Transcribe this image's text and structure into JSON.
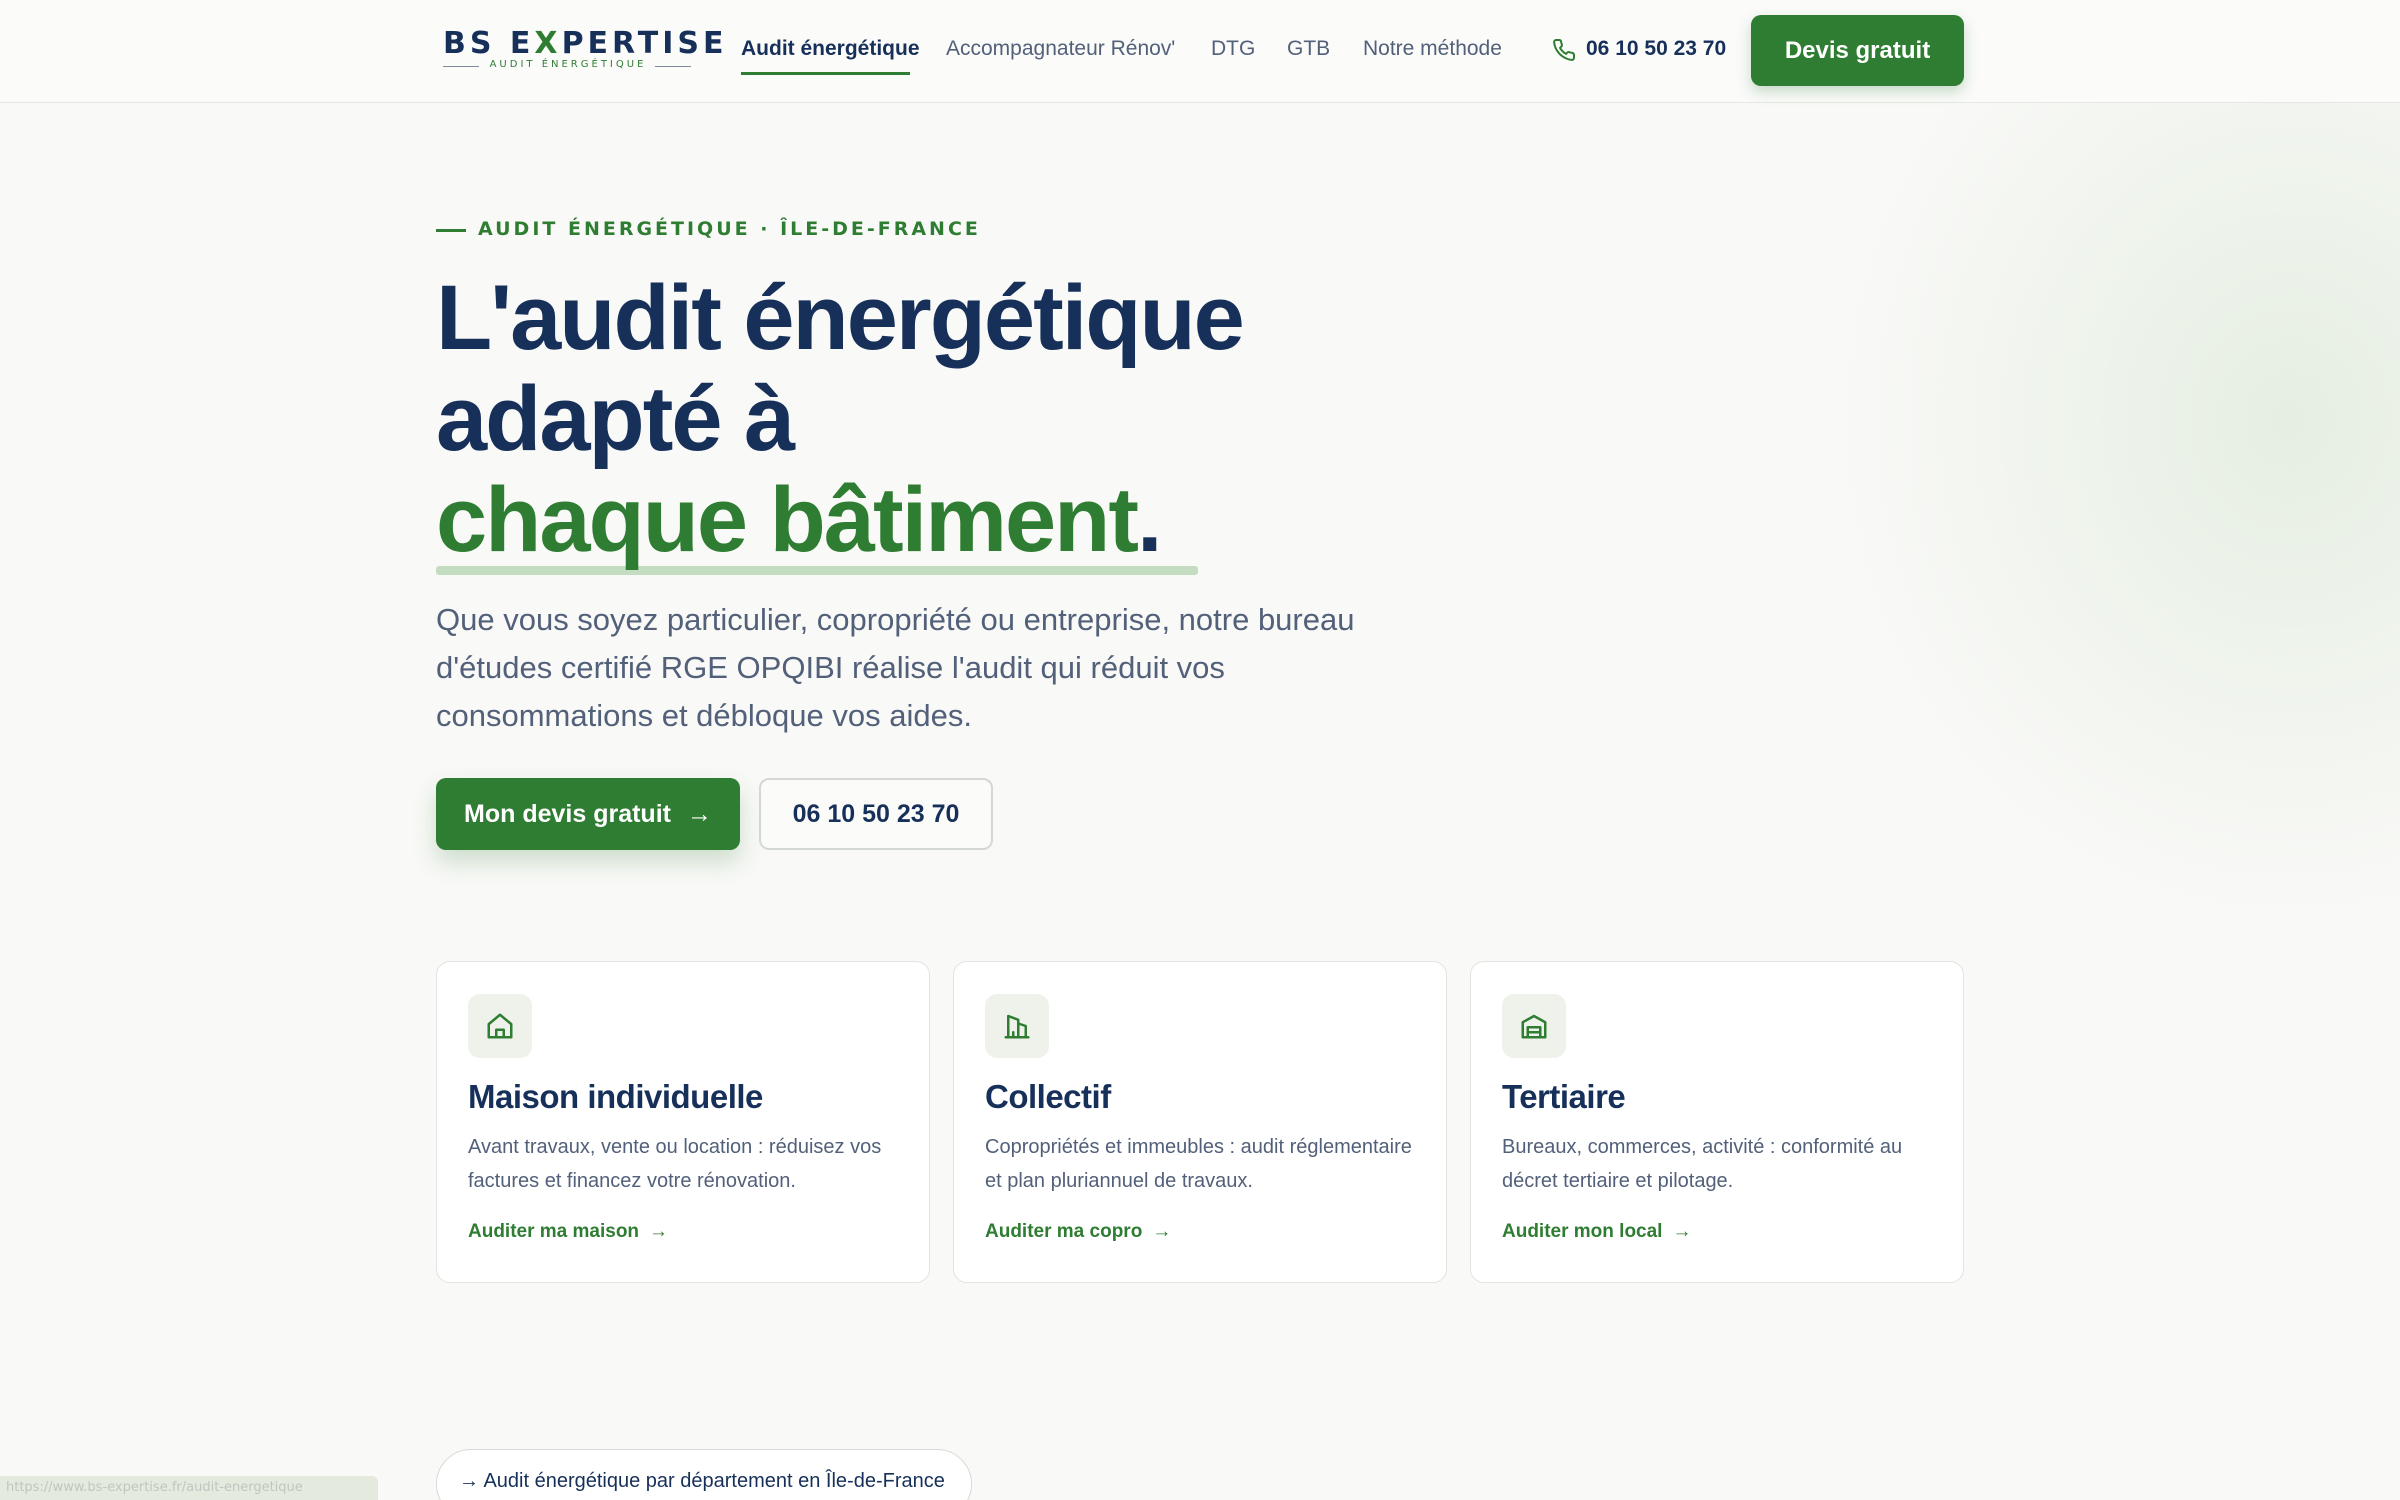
{
  "header": {
    "logo": {
      "name_prefix": "BS E",
      "name_x": "X",
      "name_suffix": "PERTISE",
      "tagline": "AUDIT ÉNERGÉTIQUE"
    },
    "nav": [
      {
        "label": "Audit énergétique",
        "active": true
      },
      {
        "label": "Accompagnateur Rénov'",
        "active": false
      },
      {
        "label": "DTG",
        "active": false
      },
      {
        "label": "GTB",
        "active": false
      },
      {
        "label": "Notre méthode",
        "active": false
      }
    ],
    "phone": "06 10 50 23 70",
    "cta_label": "Devis gratuit"
  },
  "hero": {
    "eyebrow": "AUDIT ÉNERGÉTIQUE · ÎLE-DE-FRANCE",
    "title_line1": "L'audit énergétique",
    "title_line2": "adapté à",
    "title_line3": "chaque bâtiment",
    "title_dot": ".",
    "lead": "Que vous soyez particulier, copropriété ou entreprise, notre bureau d'études certifié RGE OPQIBI réalise l'audit qui réduit vos consommations et débloque vos aides.",
    "primary_cta": "Mon devis gratuit",
    "primary_cta_arrow": "→",
    "secondary_cta": "06 10 50 23 70"
  },
  "cards": [
    {
      "icon": "house-icon",
      "title": "Maison individuelle",
      "description": "Avant travaux, vente ou location : réduisez vos factures et financez votre rénovation.",
      "link": "Auditer ma maison",
      "arrow": "→"
    },
    {
      "icon": "building-icon",
      "title": "Collectif",
      "description": "Copropriétés et immeubles : audit réglementaire et plan pluriannuel de travaux.",
      "link": "Auditer ma copro",
      "arrow": "→"
    },
    {
      "icon": "warehouse-icon",
      "title": "Tertiaire",
      "description": "Bureaux, commerces, activité : conformité au décret tertiaire et pilotage.",
      "link": "Auditer mon local",
      "arrow": "→"
    }
  ],
  "department_link": "→ Audit énergétique par département en Île-de-France",
  "status_bar_url": "https://www.bs-expertise.fr/audit-energetique",
  "colors": {
    "brand_green": "#2f7d32",
    "navy": "#17305a",
    "muted": "#52607a",
    "background": "#f9f9f7"
  }
}
